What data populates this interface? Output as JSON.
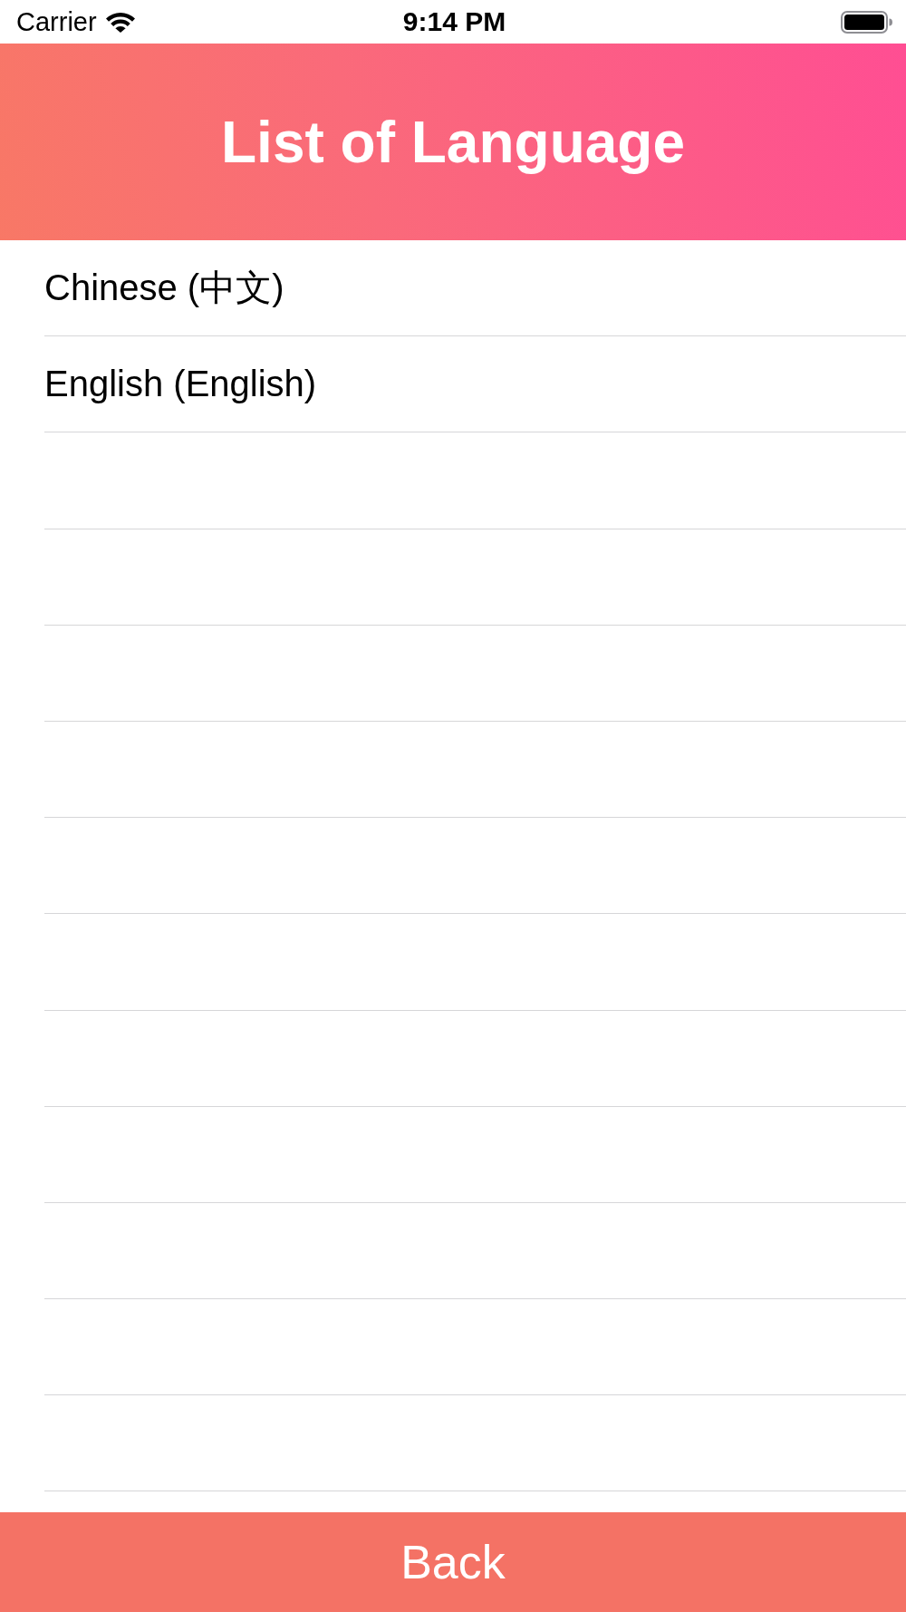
{
  "status_bar": {
    "carrier": "Carrier",
    "time": "9:14 PM"
  },
  "header": {
    "title": "List of Language"
  },
  "languages": [
    {
      "label": "Chinese (中文)"
    },
    {
      "label": "English (English)"
    }
  ],
  "back_button": {
    "label": "Back"
  }
}
